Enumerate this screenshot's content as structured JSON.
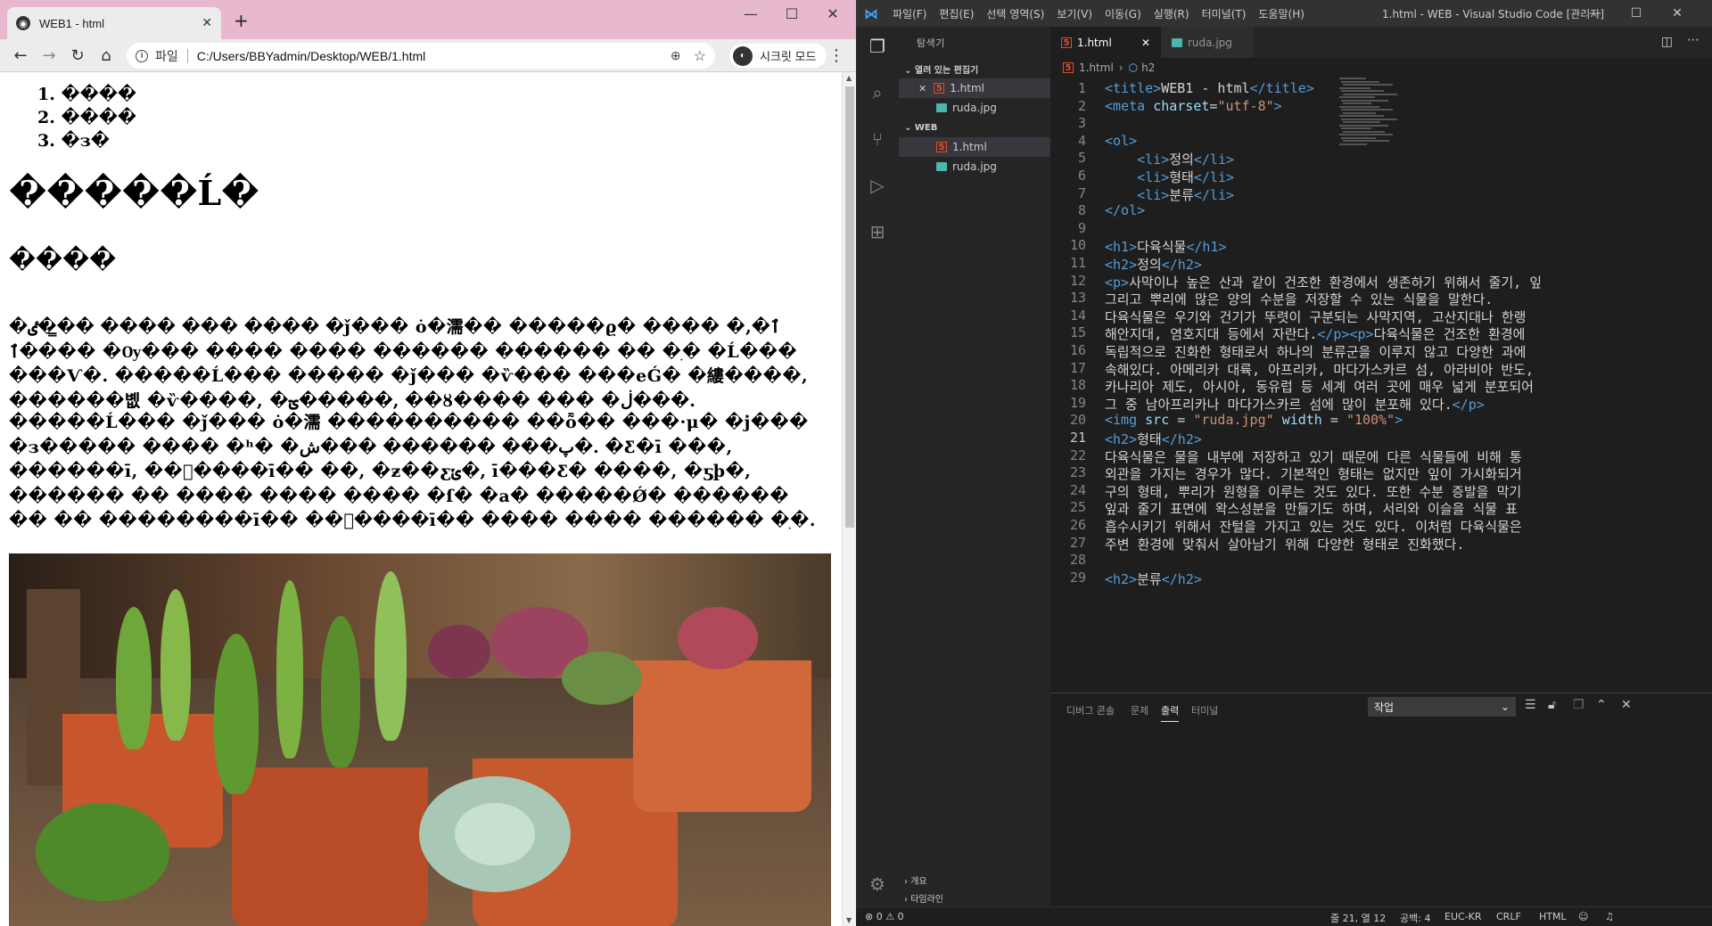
{
  "browser": {
    "tab_title": "WEB1 - html",
    "address_scheme": "파일",
    "address_url": "C:/Users/BBYadmin/Desktop/WEB/1.html",
    "incognito_label": "시크릿 모드",
    "page": {
      "list_items": [
        "1. ����",
        "2. ����",
        "3. �з�"
      ],
      "h1": "�����Ĺ�",
      "h2": "����",
      "p1": "�ٸ��̳� ���� ��� ���� �ǰ��� ȯ�濡�� �����ϱ� ���� �ٱ�, �ٱ׸��� �Ѹ��� ���� ���� ������ ������ �� �ִ� �Ĺ��� ���Ѵ�. �����Ĺ��� ����� �ǰ��� �ѷ��� ���еǴ� �縷����, ������볪 �ѷ����, �ؾ�����, ��ȣ���� ��� �ڶ���.",
      "p2": "�����Ĺ��� �ǰ��� ȯ�濡 ���������� ��ȭ�� ���·μ� �ϳ��� �з����� �̷��� �ʰ� �پ��� ������ ���ش�. �Ƹ޸�ī ���, ������ī, ���ٰ���ī�� ��, �ƶ��ƹݵ�, ī���Ƹ� ����, �ƽþ�, ������ �� ���� ���� ���� �ſ� �а� �����Ǿ� ������ �� �� ��������ī�� ���ٰ���ī�� ���� ���� ������ �ִ�.",
      "image_alt": "succulent plants photo"
    }
  },
  "vscode": {
    "menu": [
      "파일(F)",
      "편집(E)",
      "선택 영역(S)",
      "보기(V)",
      "이동(G)",
      "실행(R)",
      "터미널(T)",
      "도움말(H)"
    ],
    "window_title": "1.html - WEB - Visual Studio Code [관리자]",
    "sidebar": {
      "header": "탐색기",
      "open_editors_label": "열려 있는 편집기",
      "open_editors": [
        "1.html",
        "ruda.jpg"
      ],
      "folder_label": "WEB",
      "folder_files": [
        "1.html",
        "ruda.jpg"
      ],
      "outline_label": "개요",
      "timeline_label": "타임라인"
    },
    "tabs": [
      "1.html",
      "ruda.jpg"
    ],
    "breadcrumb": [
      "1.html",
      "h2"
    ],
    "code_lines": [
      {
        "n": "1",
        "html": "<span class='tg'>&lt;title&gt;</span>WEB1 - html<span class='tg'>&lt;/title&gt;</span>"
      },
      {
        "n": "2",
        "html": "<span class='tg'>&lt;meta</span> <span class='at'>charset</span>=<span class='st'>\"utf-8\"</span><span class='tg'>&gt;</span>"
      },
      {
        "n": "3",
        "html": ""
      },
      {
        "n": "4",
        "html": "<span class='tg'>&lt;ol&gt;</span>"
      },
      {
        "n": "5",
        "html": "    <span class='tg'>&lt;li&gt;</span>정의<span class='tg'>&lt;/li&gt;</span>"
      },
      {
        "n": "6",
        "html": "    <span class='tg'>&lt;li&gt;</span>형태<span class='tg'>&lt;/li&gt;</span>"
      },
      {
        "n": "7",
        "html": "    <span class='tg'>&lt;li&gt;</span>분류<span class='tg'>&lt;/li&gt;</span>"
      },
      {
        "n": "8",
        "html": "<span class='tg'>&lt;/ol&gt;</span>"
      },
      {
        "n": "9",
        "html": ""
      },
      {
        "n": "10",
        "html": "<span class='tg'>&lt;h1&gt;</span>다육식물<span class='tg'>&lt;/h1&gt;</span>"
      },
      {
        "n": "11",
        "html": "<span class='tg'>&lt;h2&gt;</span>정의<span class='tg'>&lt;/h2&gt;</span>"
      },
      {
        "n": "12",
        "html": "<span class='tg'>&lt;p&gt;</span>사막이나 높은 산과 같이 건조한 환경에서 생존하기 위해서 줄기, 잎"
      },
      {
        "n": "13",
        "html": "그리고 뿌리에 많은 양의 수분을 저장할 수 있는 식물을 말한다."
      },
      {
        "n": "14",
        "html": "다육식물은 우기와 건기가 뚜렷이 구분되는 사막지역, 고산지대나 한랭"
      },
      {
        "n": "15",
        "html": "해안지대, 염호지대 등에서 자란다.<span class='tg'>&lt;/p&gt;&lt;p&gt;</span>다육식물은 건조한 환경에"
      },
      {
        "n": "16",
        "html": "독립적으로 진화한 형태로서 하나의 분류군을 이루지 않고 다양한 과에"
      },
      {
        "n": "17",
        "html": "속해있다. 아메리카 대륙, 아프리카, 마다가스카르 섬, 아라비아 반도,"
      },
      {
        "n": "18",
        "html": "카나리아 제도, 아시아, 동유럽 등 세계 여러 곳에 매우 넓게 분포되어"
      },
      {
        "n": "19",
        "html": "그 중 남아프리카나 마다가스카르 섬에 많이 분포해 있다.<span class='tg'>&lt;/p&gt;</span>"
      },
      {
        "n": "20",
        "html": "<span class='tg'>&lt;img</span> <span class='at'>src</span> = <span class='st'>\"ruda.jpg\"</span> <span class='at'>width</span> = <span class='st'>\"100%\"</span><span class='tg'>&gt;</span>"
      },
      {
        "n": "21",
        "html": "<span class='tg'>&lt;h2&gt;</span>형태<span class='tg'>&lt;/h2&gt;</span>"
      },
      {
        "n": "22",
        "html": "다육식물은 물을 내부에 저장하고 있기 때문에 다른 식물들에 비해 통"
      },
      {
        "n": "23",
        "html": "외관을 가지는 경우가 많다. 기본적인 형태는 없지만 잎이 가시화되거"
      },
      {
        "n": "24",
        "html": "구의 형태, 뿌리가 원형을 이루는 것도 있다. 또한 수분 증발을 막기"
      },
      {
        "n": "25",
        "html": "잎과 줄기 표면에 왁스성분을 만들기도 하며, 서리와 이슬을 식물 표"
      },
      {
        "n": "26",
        "html": "흡수시키기 위해서 잔털을 가지고 있는 것도 있다. 이처럼 다육식물은"
      },
      {
        "n": "27",
        "html": "주변 환경에 맞춰서 살아남기 위해 다양한 형태로 진화했다."
      },
      {
        "n": "28",
        "html": ""
      },
      {
        "n": "29",
        "html": "<span class='tg'>&lt;h2&gt;</span>분류<span class='tg'>&lt;/h2&gt;</span>"
      }
    ],
    "panel": {
      "tabs": [
        "디버그 콘솔",
        "문제",
        "출력",
        "터미널"
      ],
      "active_tab": "출력",
      "select_value": "작업"
    },
    "status": {
      "problems": "⊗ 0 ⚠ 0",
      "position": "줄 21, 열 12",
      "spaces": "공백: 4",
      "encoding": "EUC-KR",
      "eol": "CRLF",
      "language": "HTML"
    }
  }
}
